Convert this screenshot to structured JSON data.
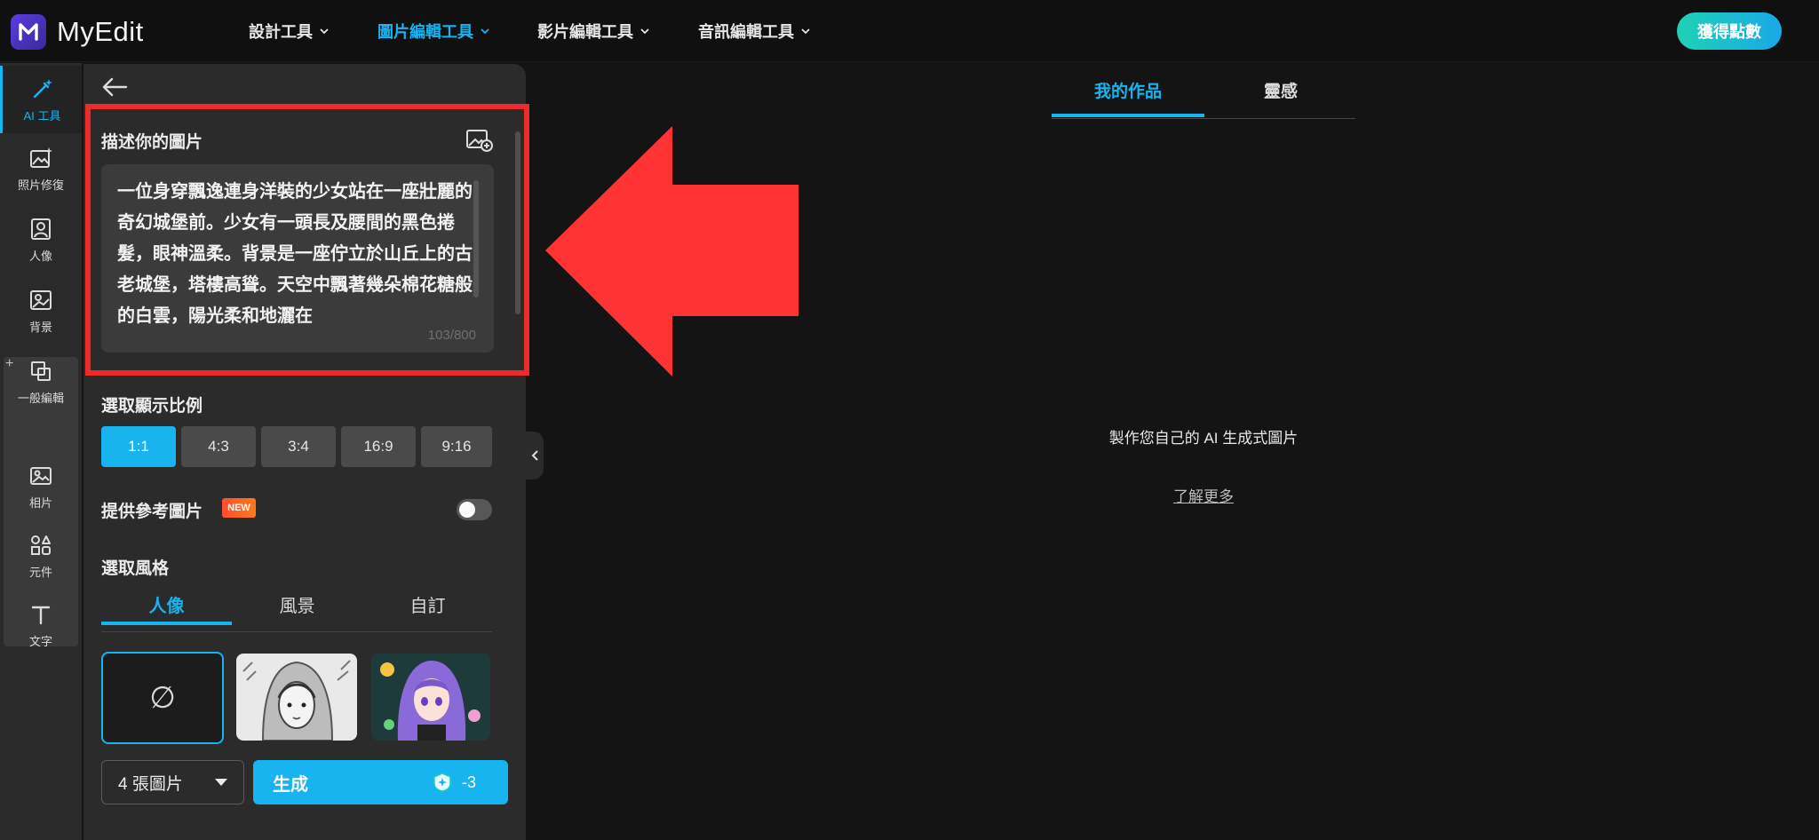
{
  "header": {
    "brand": "MyEdit",
    "nav": [
      {
        "label": "設計工具"
      },
      {
        "label": "圖片編輯工具"
      },
      {
        "label": "影片編輯工具"
      },
      {
        "label": "音訊編輯工具"
      }
    ],
    "points_button": "獲得點數",
    "accent": "#18b4f0"
  },
  "sidebar": {
    "items": [
      {
        "label": "AI 工具",
        "icon": "magic-wand-icon"
      },
      {
        "label": "照片修復",
        "icon": "photo-repair-icon"
      },
      {
        "label": "人像",
        "icon": "portrait-icon"
      },
      {
        "label": "背景",
        "icon": "background-icon"
      },
      {
        "label": "一般編輯",
        "icon": "crop-icon"
      },
      {
        "label": "相片",
        "icon": "image-icon"
      },
      {
        "label": "元件",
        "icon": "shapes-icon"
      },
      {
        "label": "文字",
        "icon": "text-icon"
      }
    ],
    "group_add": "+"
  },
  "panel": {
    "prompt_label": "描述你的圖片",
    "prompt_text": "一位身穿飄逸連身洋裝的少女站在一座壯麗的奇幻城堡前。少女有一頭長及腰間的黑色捲髮，眼神溫柔。背景是一座佇立於山丘上的古老城堡，塔樓高聳。天空中飄著幾朵棉花糖般的白雲，陽光柔和地灑在",
    "char_count": "103/800",
    "ratio_label": "選取顯示比例",
    "ratios": [
      "1:1",
      "4:3",
      "3:4",
      "16:9",
      "9:16"
    ],
    "reference_label": "提供參考圖片",
    "new_badge": "NEW",
    "style_label": "選取風格",
    "style_tabs": [
      "人像",
      "風景",
      "自訂"
    ],
    "none_symbol": "∅",
    "count_select": "4 張圖片",
    "generate": "生成",
    "cost": "-3"
  },
  "main": {
    "tabs": [
      "我的作品",
      "靈感"
    ],
    "empty_text": "製作您自己的 AI 生成式圖片",
    "learn_more": "了解更多"
  }
}
